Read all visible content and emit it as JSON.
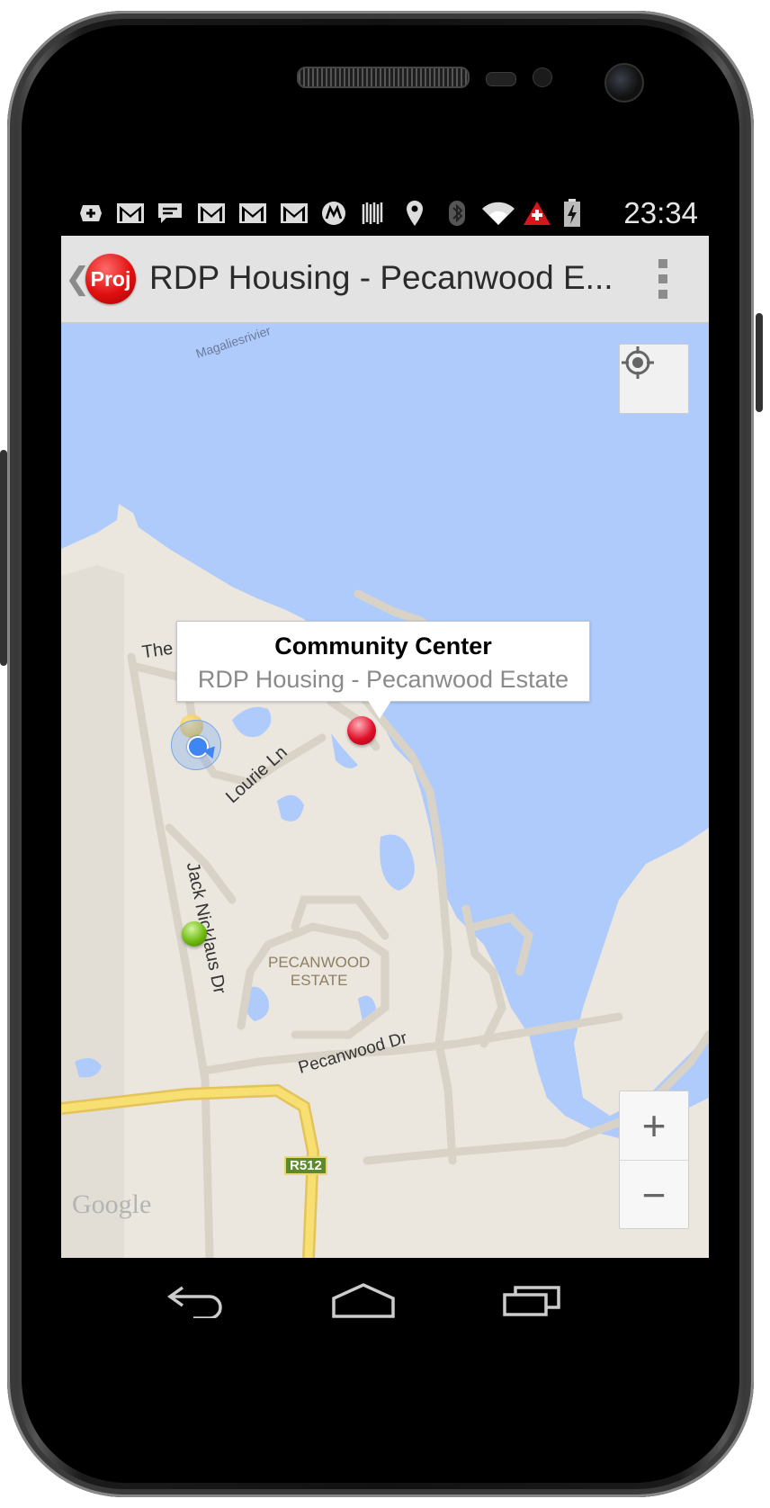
{
  "status_bar": {
    "time": "23:34",
    "icons": [
      "add-notification-icon",
      "gmail-icon",
      "chat-icon",
      "gmail-icon",
      "gmail-icon",
      "gmail-icon",
      "motorola-icon",
      "barcode-icon",
      "location-pin-icon",
      "bluetooth-icon",
      "wifi-icon",
      "warning-cross-icon",
      "battery-charging-icon"
    ]
  },
  "action_bar": {
    "app_icon_text": "Proj",
    "title": "RDP Housing - Pecanwood E..."
  },
  "map": {
    "labels": {
      "river": "Magaliesrivier",
      "road1": "The",
      "road2": "Lourie Ln",
      "road3": "Jack Nicklaus Dr",
      "road4": "Pecanwood Dr",
      "estate_line1": "PECANWOOD",
      "estate_line2": "ESTATE",
      "route": "R512",
      "logo": "Google"
    },
    "info_window": {
      "title": "Community Center",
      "subtitle": "RDP Housing - Pecanwood Estate"
    },
    "zoom_in": "+",
    "zoom_out": "−",
    "colors": {
      "water": "#aecbfb",
      "land": "#ebe7df",
      "road": "#d9d3c7",
      "highway": "#f7df72"
    }
  },
  "markers": [
    {
      "name": "red-marker",
      "color": "#e0102a"
    },
    {
      "name": "yellow-marker",
      "color": "#f3c74a"
    },
    {
      "name": "green-marker",
      "color": "#6fba12"
    },
    {
      "name": "my-location-dot",
      "color": "#3f86f2"
    }
  ]
}
